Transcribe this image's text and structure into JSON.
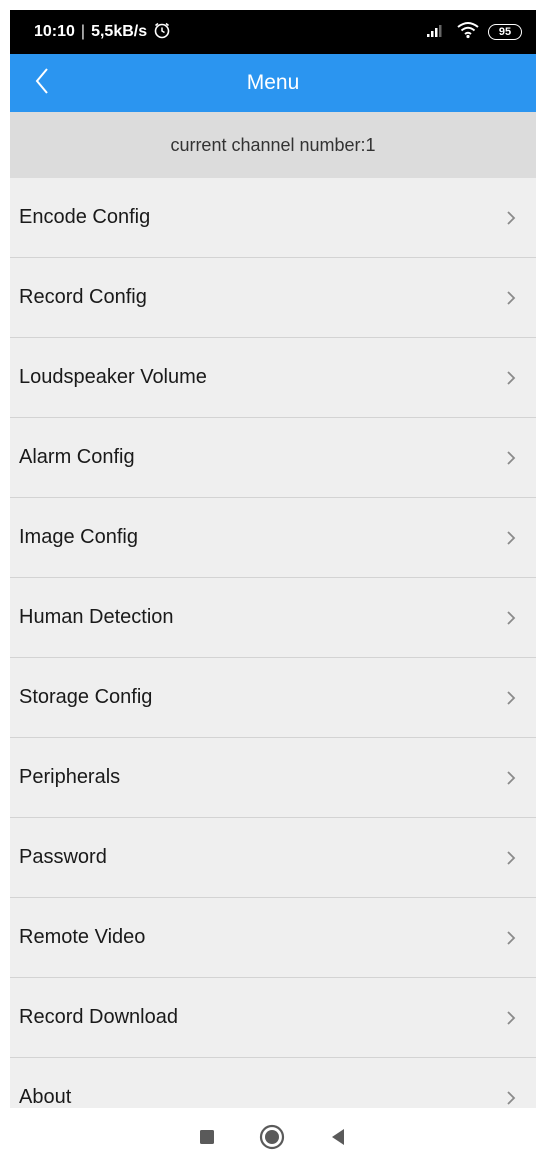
{
  "status_bar": {
    "time": "10:10",
    "separator": "|",
    "speed": "5,5kB/s",
    "battery": "95",
    "icons": [
      "alarm-icon",
      "signal-icon",
      "wifi-icon",
      "battery-icon"
    ]
  },
  "header": {
    "title": "Menu",
    "back_icon": "back-chevron-icon",
    "background_color": "#2b95f0"
  },
  "channel": {
    "label": "current channel number:1"
  },
  "menu": {
    "items": [
      {
        "label": "Encode Config"
      },
      {
        "label": "Record Config"
      },
      {
        "label": "Loudspeaker Volume"
      },
      {
        "label": "Alarm Config"
      },
      {
        "label": "Image Config"
      },
      {
        "label": "Human Detection"
      },
      {
        "label": "Storage Config"
      },
      {
        "label": "Peripherals"
      },
      {
        "label": "Password"
      },
      {
        "label": "Remote Video"
      },
      {
        "label": "Record Download"
      },
      {
        "label": "About"
      }
    ],
    "item_icon": "chevron-right-icon"
  },
  "nav_bar": {
    "buttons": [
      "recents-square-icon",
      "home-circle-icon",
      "back-triangle-icon"
    ]
  }
}
